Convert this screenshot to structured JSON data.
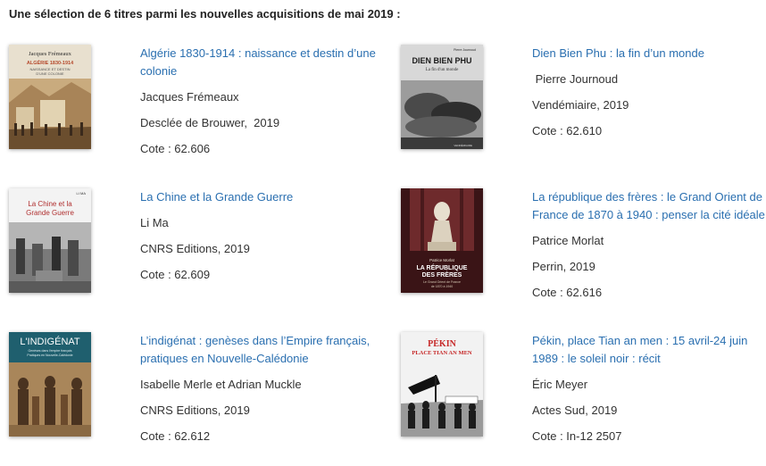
{
  "heading": "Une sélection de 6 titres parmi les nouvelles acquisitions de mai 2019 :",
  "colors": {
    "link": "#2a6fb0",
    "text": "#333333"
  },
  "books": [
    {
      "title": "Algérie 1830-1914 : naissance et destin d’une colonie",
      "author": "Jacques Frémeaux",
      "publisher": "Desclée de Brouwer,  2019",
      "cote": "Cote : 62.606",
      "cover": {
        "lines": [
          "Jacques Frémeaux",
          "ALGÉRIE 1830-1914",
          "NAISSANCE ET DESTIN",
          "D'UNE COLONIE"
        ],
        "accent": "#b5492c"
      }
    },
    {
      "title": "Dien Bien Phu : la fin d’un monde",
      "author": " Pierre Journoud",
      "publisher": "Vendémiaire, 2019",
      "cote": "Cote : 62.610",
      "cover": {
        "lines": [
          "Pierre Journoud",
          "DIEN BIEN PHU",
          "La fin d'un monde",
          "VENDÉMIAIRE"
        ],
        "accent": "#2c2c2c"
      }
    },
    {
      "title": "La Chine et la Grande Guerre",
      "author": "Li Ma",
      "publisher": "CNRS Editions, 2019",
      "cote": "Cote : 62.609",
      "cover": {
        "lines": [
          "LI MA",
          "La Chine et la",
          "Grande Guerre"
        ],
        "accent": "#b03030"
      }
    },
    {
      "title": "La république des frères : le Grand Orient de France de 1870 à 1940 : penser la cité idéale",
      "author": "Patrice Morlat",
      "publisher": "Perrin, 2019",
      "cote": "Cote : 62.616",
      "cover": {
        "lines": [
          "Patrice Morlat",
          "LA RÉPUBLIQUE",
          "DES FRÈRES",
          "Le Grand Orient de France",
          "de 1870 à 1940"
        ],
        "accent": "#5a1d22"
      }
    },
    {
      "title": "L’indigénat : genèses dans l’Empire français, pratiques en Nouvelle-Calédonie",
      "author": "Isabelle Merle et Adrian Muckle",
      "publisher": "CNRS Editions, 2019",
      "cote": "Cote : 62.612",
      "cover": {
        "lines": [
          "L'INDIGÉNAT",
          "Genèses dans l'empire français",
          "Pratiques en Nouvelle-Calédonie"
        ],
        "accent": "#1f5f6e"
      }
    },
    {
      "title": "Pékin, place Tian an men : 15 avril-24 juin 1989 : le soleil noir : récit",
      "author": "Éric Meyer",
      "publisher": "Actes Sud, 2019",
      "cote": "Cote : In-12 2507",
      "cover": {
        "lines": [
          "PÉKIN",
          "PLACE TIAN AN MEN"
        ],
        "accent": "#c62828"
      }
    }
  ]
}
